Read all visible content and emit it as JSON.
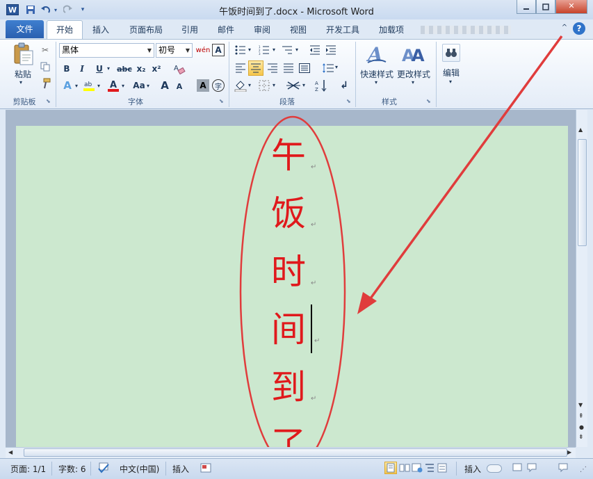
{
  "window": {
    "title": "午饭时间到了.docx - Microsoft Word"
  },
  "quick_access": {
    "app_icon": "W"
  },
  "tabs": [
    "文件",
    "开始",
    "插入",
    "页面布局",
    "引用",
    "邮件",
    "审阅",
    "视图",
    "开发工具",
    "加载项"
  ],
  "ribbon": {
    "clipboard": {
      "paste_label": "粘贴",
      "group_label": "剪贴板"
    },
    "font": {
      "font_name": "黑体",
      "font_size": "初号",
      "bold": "B",
      "italic": "I",
      "underline": "U",
      "strike": "abc",
      "sub": "x₂",
      "sup": "x²",
      "grow": "A",
      "shrink": "A",
      "case": "Aa",
      "group_label": "字体"
    },
    "paragraph": {
      "group_label": "段落"
    },
    "styles": {
      "quick_styles": "快速样式",
      "change_styles": "更改样式",
      "group_label": "样式"
    },
    "editing": {
      "edit_label": "编辑"
    }
  },
  "document": {
    "characters": [
      "午",
      "饭",
      "时",
      "间",
      "到",
      "了"
    ],
    "paragraph_mark": "↵"
  },
  "statusbar": {
    "page": "页面: 1/1",
    "word_count": "字数: 6",
    "language": "中文(中国)",
    "insert_mode": "插入",
    "mode_right": "插入"
  },
  "colors": {
    "page_bg": "#cce8cf",
    "text": "#e0191c",
    "annotation": "#e03c3c"
  }
}
